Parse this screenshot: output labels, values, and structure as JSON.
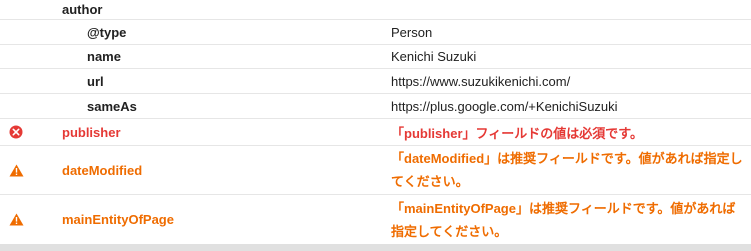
{
  "rows": {
    "author": {
      "key": "author"
    },
    "type": {
      "key": "@type",
      "value": "Person"
    },
    "name": {
      "key": "name",
      "value": "Kenichi Suzuki"
    },
    "url": {
      "key": "url",
      "value": "https://www.suzukikenichi.com/"
    },
    "sameAs": {
      "key": "sameAs",
      "value": "https://plus.google.com/+KenichiSuzuki"
    },
    "publisher": {
      "key": "publisher",
      "message": "「publisher」フィールドの値は必須です。",
      "icon": "error-icon",
      "color": "#e53935"
    },
    "dateModified": {
      "key": "dateModified",
      "message": "「dateModified」は推奨フィールドです。値があれば指定してください。",
      "icon": "warning-icon",
      "color": "#ef6c00"
    },
    "mainEntityOfPage": {
      "key": "mainEntityOfPage",
      "message": "「mainEntityOfPage」は推奨フィールドです。値があれば指定してください。",
      "icon": "warning-icon",
      "color": "#ef6c00"
    }
  }
}
